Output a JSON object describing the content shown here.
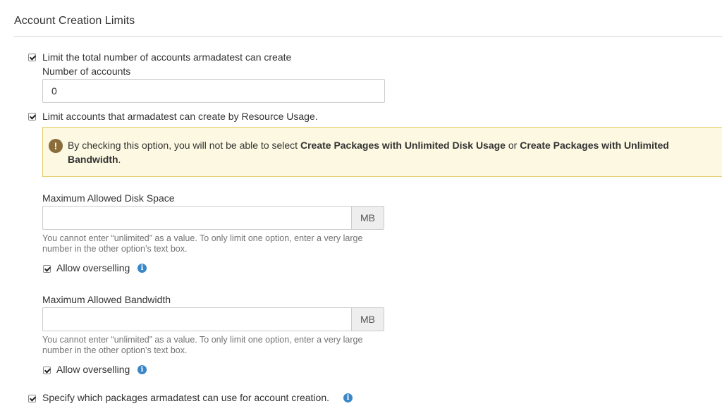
{
  "section": {
    "title": "Account Creation Limits"
  },
  "limit_total": {
    "checked": true,
    "label": "Limit the total number of accounts armadatest can create",
    "field_label": "Number of accounts",
    "value": "0"
  },
  "limit_resource": {
    "checked": true,
    "label": "Limit accounts that armadatest can create by Resource Usage."
  },
  "warning": {
    "icon": "exclamation-icon",
    "text_before": "By checking this option, you will not be able to select ",
    "bold_1": "Create Packages with Unlimited Disk Usage",
    "text_mid": " or ",
    "bold_2": "Create Packages with Unlimited Bandwidth",
    "text_after": ".",
    "color_bg": "#fcf8e1",
    "color_border": "#e6cc6a"
  },
  "disk": {
    "field_label": "Maximum Allowed Disk Space",
    "value": "",
    "unit": "MB",
    "help": "You cannot enter “unlimited” as a value. To only limit one option, enter a very large number in the other option’s text box.",
    "overselling_checked": true,
    "overselling_label": "Allow overselling"
  },
  "bandwidth": {
    "field_label": "Maximum Allowed Bandwidth",
    "value": "",
    "unit": "MB",
    "help": "You cannot enter “unlimited” as a value. To only limit one option, enter a very large number in the other option’s text box.",
    "overselling_checked": true,
    "overselling_label": "Allow overselling"
  },
  "packages": {
    "checked": true,
    "label": "Specify which packages armadatest can use for account creation."
  },
  "colors": {
    "info_icon": "#3a87c8",
    "warning_icon": "#8a6d3b"
  }
}
